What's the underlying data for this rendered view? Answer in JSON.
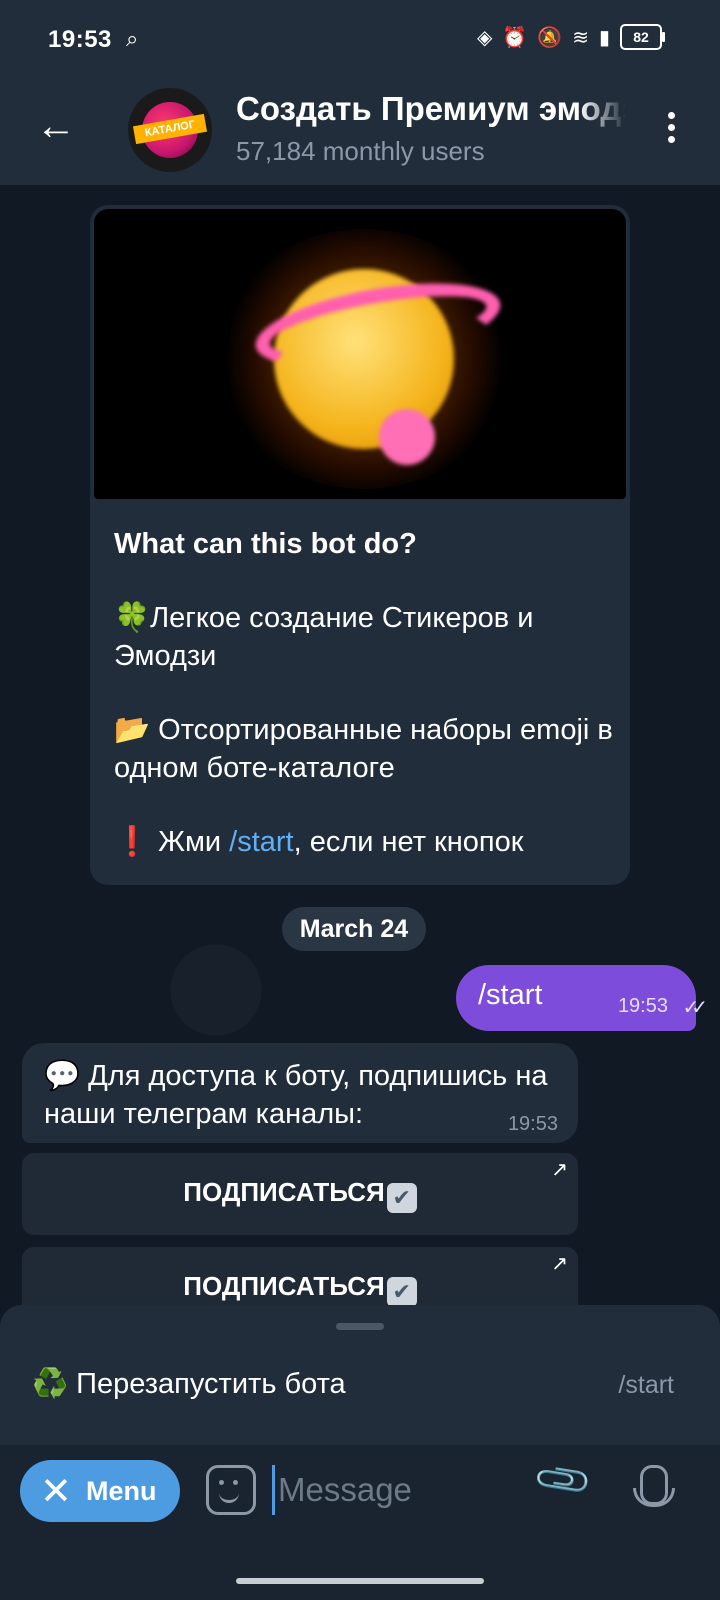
{
  "status_bar": {
    "time": "19:53",
    "search_icon": "search-icon",
    "icons": [
      "nfc-icon",
      "alarm-icon",
      "mute-icon",
      "wifi-icon",
      "volte-icon",
      "signal-icon"
    ],
    "battery": "82"
  },
  "header": {
    "title": "Создать Премиум эмодзи",
    "subtitle": "57,184 monthly users",
    "avatar_text": "КАТАЛОГ"
  },
  "bot_info": {
    "heading": "What can this bot do?",
    "line1_emoji": "🍀",
    "line1": "Легкое создание Стикеров и Эмодзи",
    "line2_emoji": "📂",
    "line2": " Отсортированные наборы emoji в одном боте-каталоге",
    "line3_emoji": "❗",
    "line3_pre": " Жми ",
    "line3_link": "/start",
    "line3_post": ", если нет кнопок"
  },
  "date_chip": "March 24",
  "messages": {
    "outgoing": {
      "text": "/start",
      "time": "19:53",
      "ticks": "✓✓"
    },
    "incoming": {
      "emoji": "💬",
      "text": " Для доступа к боту, подпишись на наши телеграм каналы:",
      "time": "19:53"
    }
  },
  "inline_buttons": [
    {
      "label": "ПОДПИСАТЬСЯ",
      "arrow": "↗"
    },
    {
      "label": "ПОДПИСАТЬСЯ",
      "arrow": "↗"
    }
  ],
  "commands": {
    "restart_emoji": "♻️",
    "restart_label": " Перезапустить бота",
    "restart_cmd": "/start"
  },
  "input_bar": {
    "menu_label": "Menu",
    "placeholder": "Message"
  },
  "colors": {
    "accent": "#4d9be0",
    "outgoing_bubble": "#7d4cdb",
    "bubble": "#212d3b",
    "link": "#5fb0f5"
  }
}
